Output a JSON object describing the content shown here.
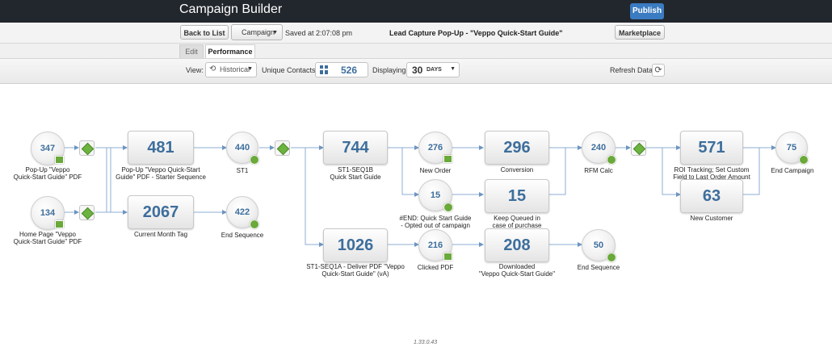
{
  "app": {
    "title": "Campaign Builder",
    "publish_label": "Publish"
  },
  "toolbar": {
    "back_label": "Back to List",
    "campaign_label": "Campaign",
    "saved_text": "Saved at 2:07:08 pm",
    "doc_title": "Lead Capture Pop-Up - \"Veppo Quick-Start Guide\"",
    "marketplace_label": "Marketplace"
  },
  "tabs": {
    "edit": "Edit",
    "performance": "Performance"
  },
  "perf": {
    "view_label": "View:",
    "view_value": "Historical",
    "contacts_label": "Unique Contacts:",
    "contacts_value": "526",
    "displaying_label": "Displaying:",
    "days_value": "30",
    "days_unit": "DAYS",
    "refresh_label": "Refresh Data:"
  },
  "nodes": {
    "popup_pdf": {
      "value": "347",
      "label": "Pop-Up \"Veppo\nQuick-Start Guide\" PDF"
    },
    "home_pdf": {
      "value": "134",
      "label": "Home Page \"Veppo\nQuick-Start Guide\" PDF"
    },
    "starter_seq": {
      "value": "481",
      "label": "Pop-Up \"Veppo Quick-Start\nGuide\" PDF - Starter Sequence"
    },
    "month_tag": {
      "value": "2067",
      "label": "Current Month Tag"
    },
    "st1": {
      "value": "440",
      "label": "ST1"
    },
    "end_seq1": {
      "value": "422",
      "label": "End Sequence"
    },
    "seq1b": {
      "value": "744",
      "label": "ST1-SEQ1B\nQuick Start Guide"
    },
    "seq1a": {
      "value": "1026",
      "label": "ST1-SEQ1A - Deliver PDF \"Veppo\nQuick-Start Guide\" (vA)"
    },
    "new_order": {
      "value": "276",
      "label": "New Order"
    },
    "end_quick": {
      "value": "15",
      "label": "#END: Quick Start Guide\n- Opted out of campaign"
    },
    "clicked_pdf": {
      "value": "216",
      "label": "Clicked PDF"
    },
    "conversion": {
      "value": "296",
      "label": "Conversion"
    },
    "keep_queued": {
      "value": "15",
      "label": "Keep Queued in\ncase of purchase"
    },
    "downloaded": {
      "value": "208",
      "label": "Downloaded\n\"Veppo Quick-Start Guide\""
    },
    "end_seq2": {
      "value": "50",
      "label": "End Sequence"
    },
    "rfm": {
      "value": "240",
      "label": "RFM Calc"
    },
    "roi": {
      "value": "571",
      "label": "ROI Tracking; Set Custom\nField to Last Order Amount"
    },
    "new_customer": {
      "value": "63",
      "label": "New Customer"
    },
    "end_campaign": {
      "value": "75",
      "label": "End Campaign"
    }
  },
  "version": "1.33.0.43",
  "colors": {
    "accent": "#3a7bc1",
    "node_text": "#3d6e9c",
    "connector": "#6b95c2",
    "goal_green": "#6cb33f"
  }
}
